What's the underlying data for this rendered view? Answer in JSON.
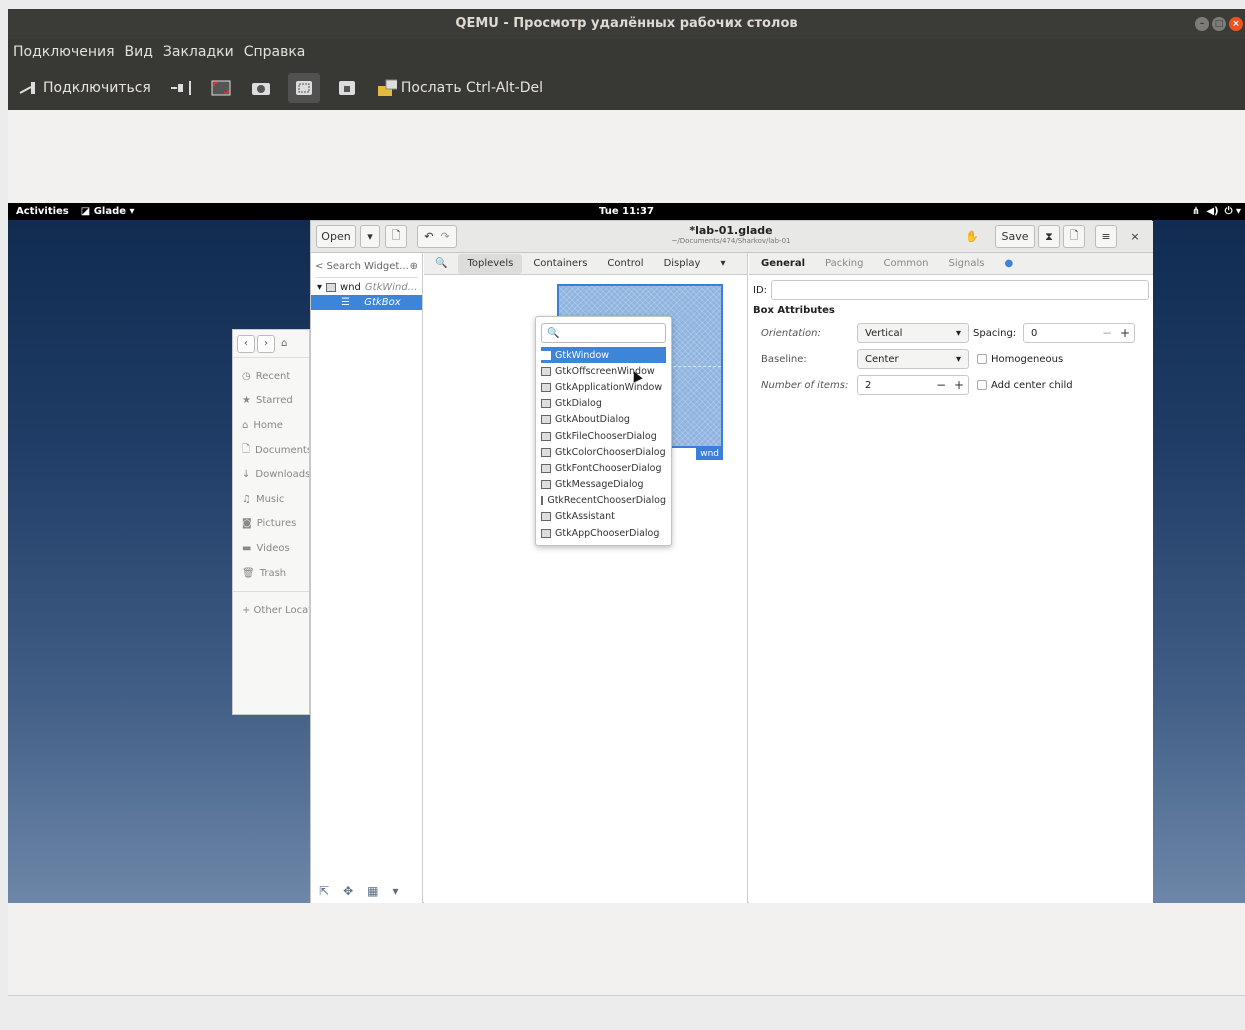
{
  "host": {
    "title": "QEMU - Просмотр удалённых рабочих столов",
    "menu": [
      "Подключения",
      "Вид",
      "Закладки",
      "Справка"
    ],
    "toolbar": {
      "connect": "Подключиться",
      "send_cad": "Послать Ctrl-Alt-Del"
    }
  },
  "vm": {
    "topbar": {
      "activities": "Activities",
      "app": "Glade ▾",
      "clock": "Tue 11:37"
    },
    "files": {
      "items": [
        "Recent",
        "Starred",
        "Home",
        "Documents",
        "Downloads",
        "Music",
        "Pictures",
        "Videos",
        "Trash"
      ],
      "icons": [
        "clock-icon",
        "star-icon",
        "home-icon",
        "document-icon",
        "download-icon",
        "music-icon",
        "camera-icon",
        "video-icon",
        "trash-icon"
      ],
      "other": "+ Other Locati"
    },
    "glade": {
      "open": "Open",
      "title": "*lab-01.glade",
      "subtitle": "~/Documents/474/Sharkov/lab-01",
      "save": "Save",
      "search_placeholder": "< Search Widget...",
      "tree": [
        {
          "name": "wnd",
          "type": "GtkWind..."
        },
        {
          "name": "GtkBox",
          "type": ""
        }
      ],
      "palette_tabs": [
        "Toplevels",
        "Containers",
        "Control",
        "Display"
      ],
      "popup_items": [
        "GtkWindow",
        "GtkOffscreenWindow",
        "GtkApplicationWindow",
        "GtkDialog",
        "GtkAboutDialog",
        "GtkFileChooserDialog",
        "GtkColorChooserDialog",
        "GtkFontChooserDialog",
        "GtkMessageDialog",
        "GtkRecentChooserDialog",
        "GtkAssistant",
        "GtkAppChooserDialog"
      ],
      "preview_label": "wnd",
      "prop_tabs": [
        "General",
        "Packing",
        "Common",
        "Signals"
      ],
      "props": {
        "id_label": "ID:",
        "section": "Box Attributes",
        "orientation_label": "Orientation:",
        "orientation": "Vertical",
        "spacing_label": "Spacing:",
        "spacing": "0",
        "baseline_label": "Baseline:",
        "baseline": "Center",
        "homogeneous": "Homogeneous",
        "items_label": "Number of items:",
        "items": "2",
        "center_child": "Add center child"
      }
    }
  },
  "colors": {
    "accent": "#3d85d8",
    "close": "#e95420"
  }
}
